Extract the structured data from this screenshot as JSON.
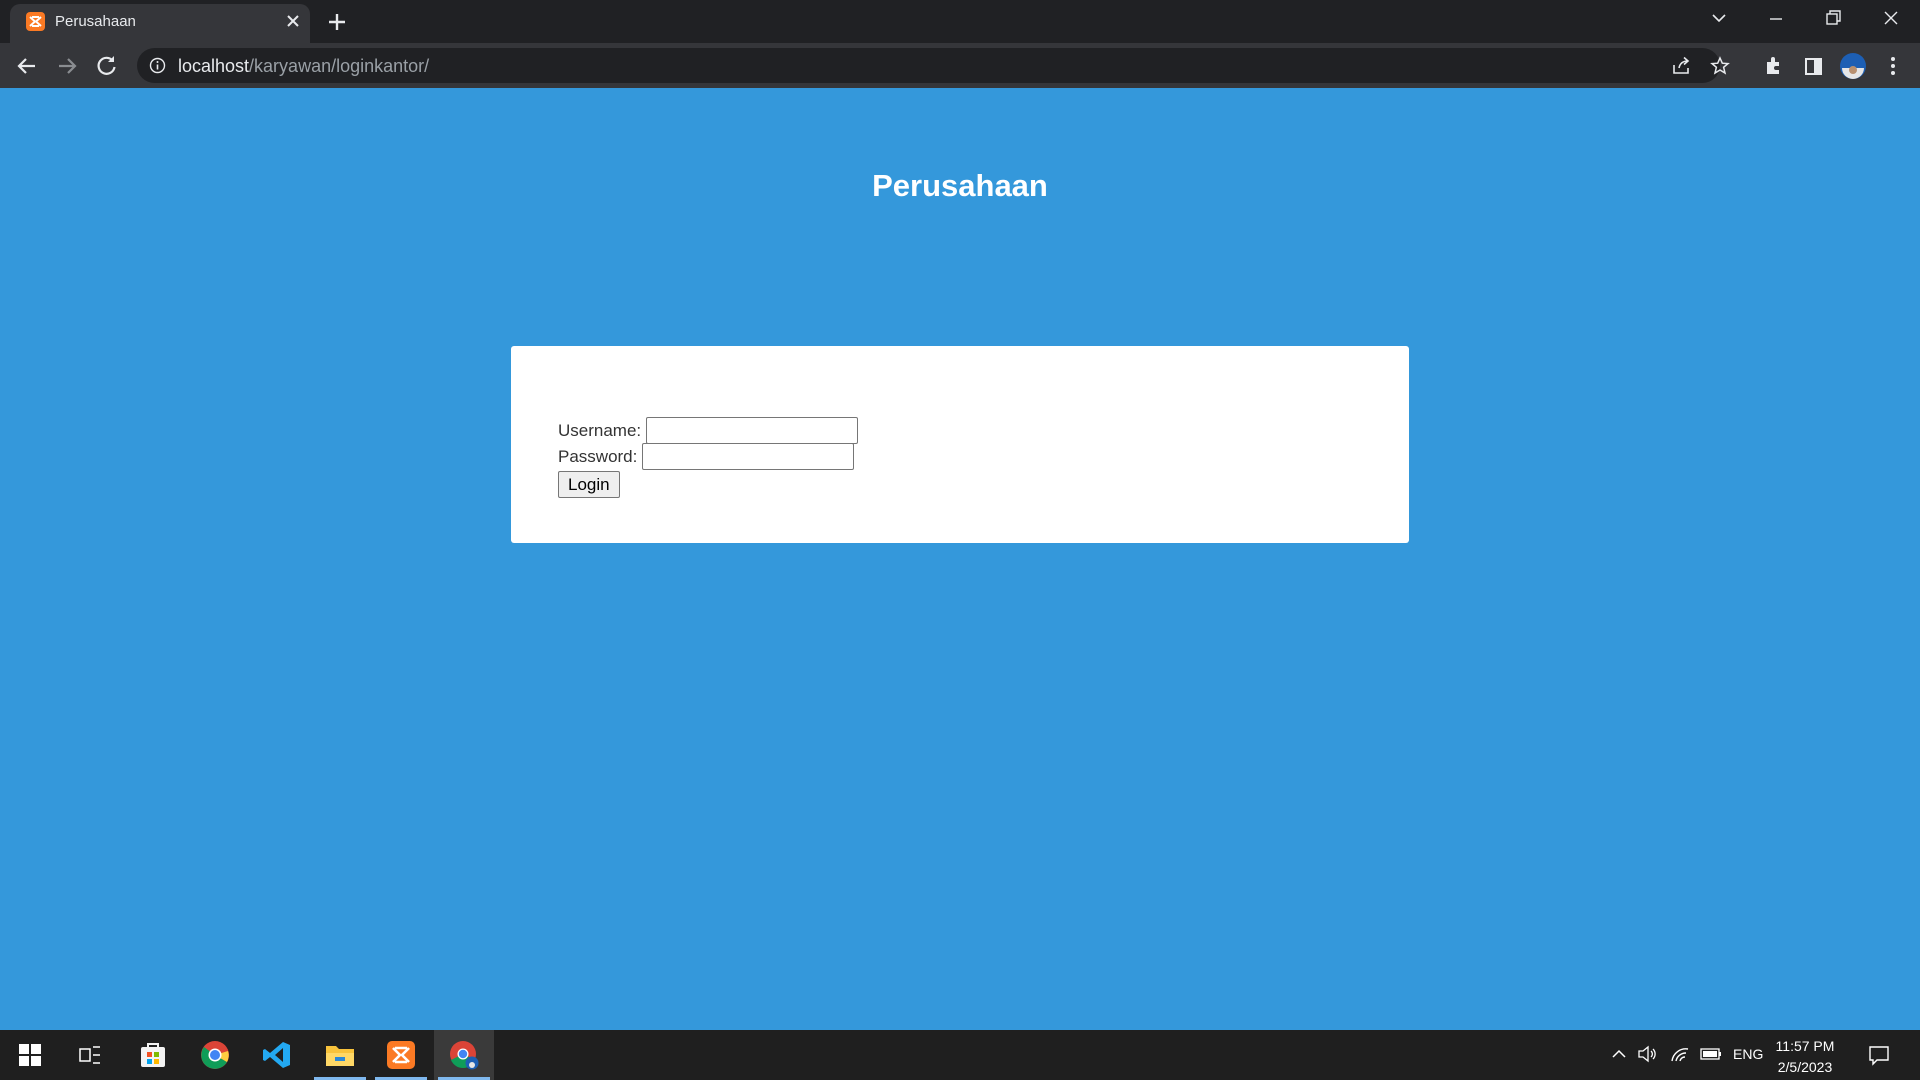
{
  "browser": {
    "tab_title": "Perusahaan",
    "url_host": "localhost",
    "url_path": "/karyawan/loginkantor/"
  },
  "page": {
    "heading": "Perusahaan",
    "form": {
      "username_label": "Username:",
      "username_value": "",
      "password_label": "Password:",
      "password_value": "",
      "login_label": "Login"
    }
  },
  "taskbar": {
    "apps": [
      "start-icon",
      "task-view-icon",
      "store-icon",
      "chrome-icon",
      "vscode-icon",
      "file-explorer-icon",
      "xampp-icon",
      "chrome-profile-icon"
    ],
    "language": "ENG",
    "time": "11:57 PM",
    "date": "2/5/2023"
  },
  "colors": {
    "page_background": "#3498db",
    "card_background": "#ffffff",
    "titlebar": "#202124",
    "toolbar": "#35363a",
    "taskbar": "#1f1f1f",
    "xampp_orange": "#fb7a24"
  }
}
